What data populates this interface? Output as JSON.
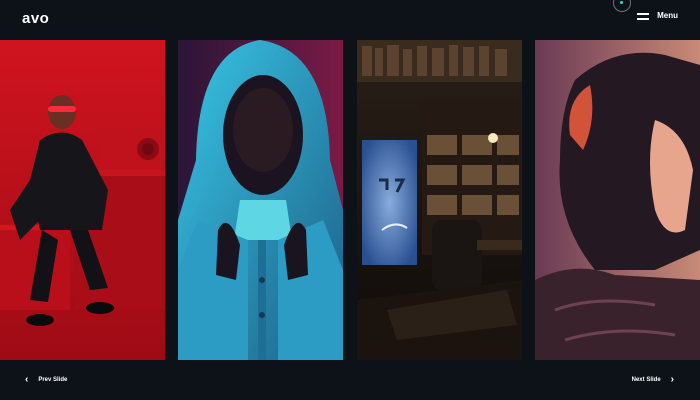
{
  "header": {
    "logo": "avo",
    "menu_label": "Menu"
  },
  "slides": [
    {
      "subject": "man in red suit with red glasses on red cubes"
    },
    {
      "subject": "person in hooded jacket with cyan and magenta light"
    },
    {
      "subject": "dark library with hologram portal"
    },
    {
      "subject": "woman in fur hood with warm rim light"
    }
  ],
  "footer": {
    "prev_label": "Prev Slide",
    "next_label": "Next Slide"
  },
  "colors": {
    "background": "#0d1218",
    "accent": "#37d6c0",
    "red": "#c2121e",
    "cyan": "#2fb7d8",
    "magenta": "#8a1f4f"
  }
}
